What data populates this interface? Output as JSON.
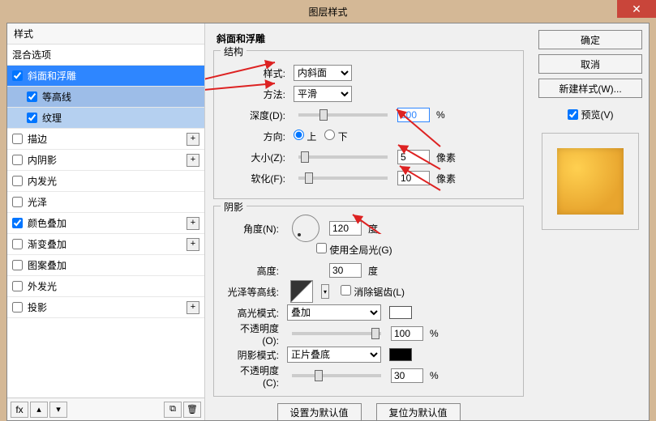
{
  "title": "图层样式",
  "styles_header": "样式",
  "styles": [
    {
      "label": "混合选项",
      "checked": null,
      "plus": false
    },
    {
      "label": "斜面和浮雕",
      "checked": true,
      "plus": false,
      "selected": true
    },
    {
      "label": "等高线",
      "checked": true,
      "plus": false,
      "sub": true
    },
    {
      "label": "纹理",
      "checked": true,
      "plus": false,
      "sub2": true
    },
    {
      "label": "描边",
      "checked": false,
      "plus": true
    },
    {
      "label": "内阴影",
      "checked": false,
      "plus": true
    },
    {
      "label": "内发光",
      "checked": false,
      "plus": false
    },
    {
      "label": "光泽",
      "checked": false,
      "plus": false
    },
    {
      "label": "颜色叠加",
      "checked": true,
      "plus": true
    },
    {
      "label": "渐变叠加",
      "checked": false,
      "plus": true
    },
    {
      "label": "图案叠加",
      "checked": false,
      "plus": false
    },
    {
      "label": "外发光",
      "checked": false,
      "plus": false
    },
    {
      "label": "投影",
      "checked": false,
      "plus": true
    }
  ],
  "panel_title": "斜面和浮雕",
  "structure": {
    "group": "结构",
    "style_label": "样式:",
    "style_value": "内斜面",
    "method_label": "方法:",
    "method_value": "平滑",
    "depth_label": "深度(D):",
    "depth_value": "300",
    "depth_unit": "%",
    "direction_label": "方向:",
    "up": "上",
    "down": "下",
    "size_label": "大小(Z):",
    "size_value": "5",
    "size_unit": "像素",
    "soften_label": "软化(F):",
    "soften_value": "10",
    "soften_unit": "像素"
  },
  "shading": {
    "group": "阴影",
    "angle_label": "角度(N):",
    "angle_value": "120",
    "angle_unit": "度",
    "global_label": "使用全局光(G)",
    "altitude_label": "高度:",
    "altitude_value": "30",
    "altitude_unit": "度",
    "gloss_label": "光泽等高线:",
    "antialias_label": "消除锯齿(L)",
    "hl_mode_label": "高光模式:",
    "hl_mode_value": "叠加",
    "hl_opacity_label": "不透明度(O):",
    "hl_opacity_value": "100",
    "pct": "%",
    "sh_mode_label": "阴影模式:",
    "sh_mode_value": "正片叠底",
    "sh_opacity_label": "不透明度(C):",
    "sh_opacity_value": "30"
  },
  "buttons": {
    "default": "设置为默认值",
    "reset": "复位为默认值"
  },
  "right": {
    "ok": "确定",
    "cancel": "取消",
    "newstyle": "新建样式(W)...",
    "preview": "预览(V)"
  },
  "footer": {
    "fx": "fx"
  }
}
